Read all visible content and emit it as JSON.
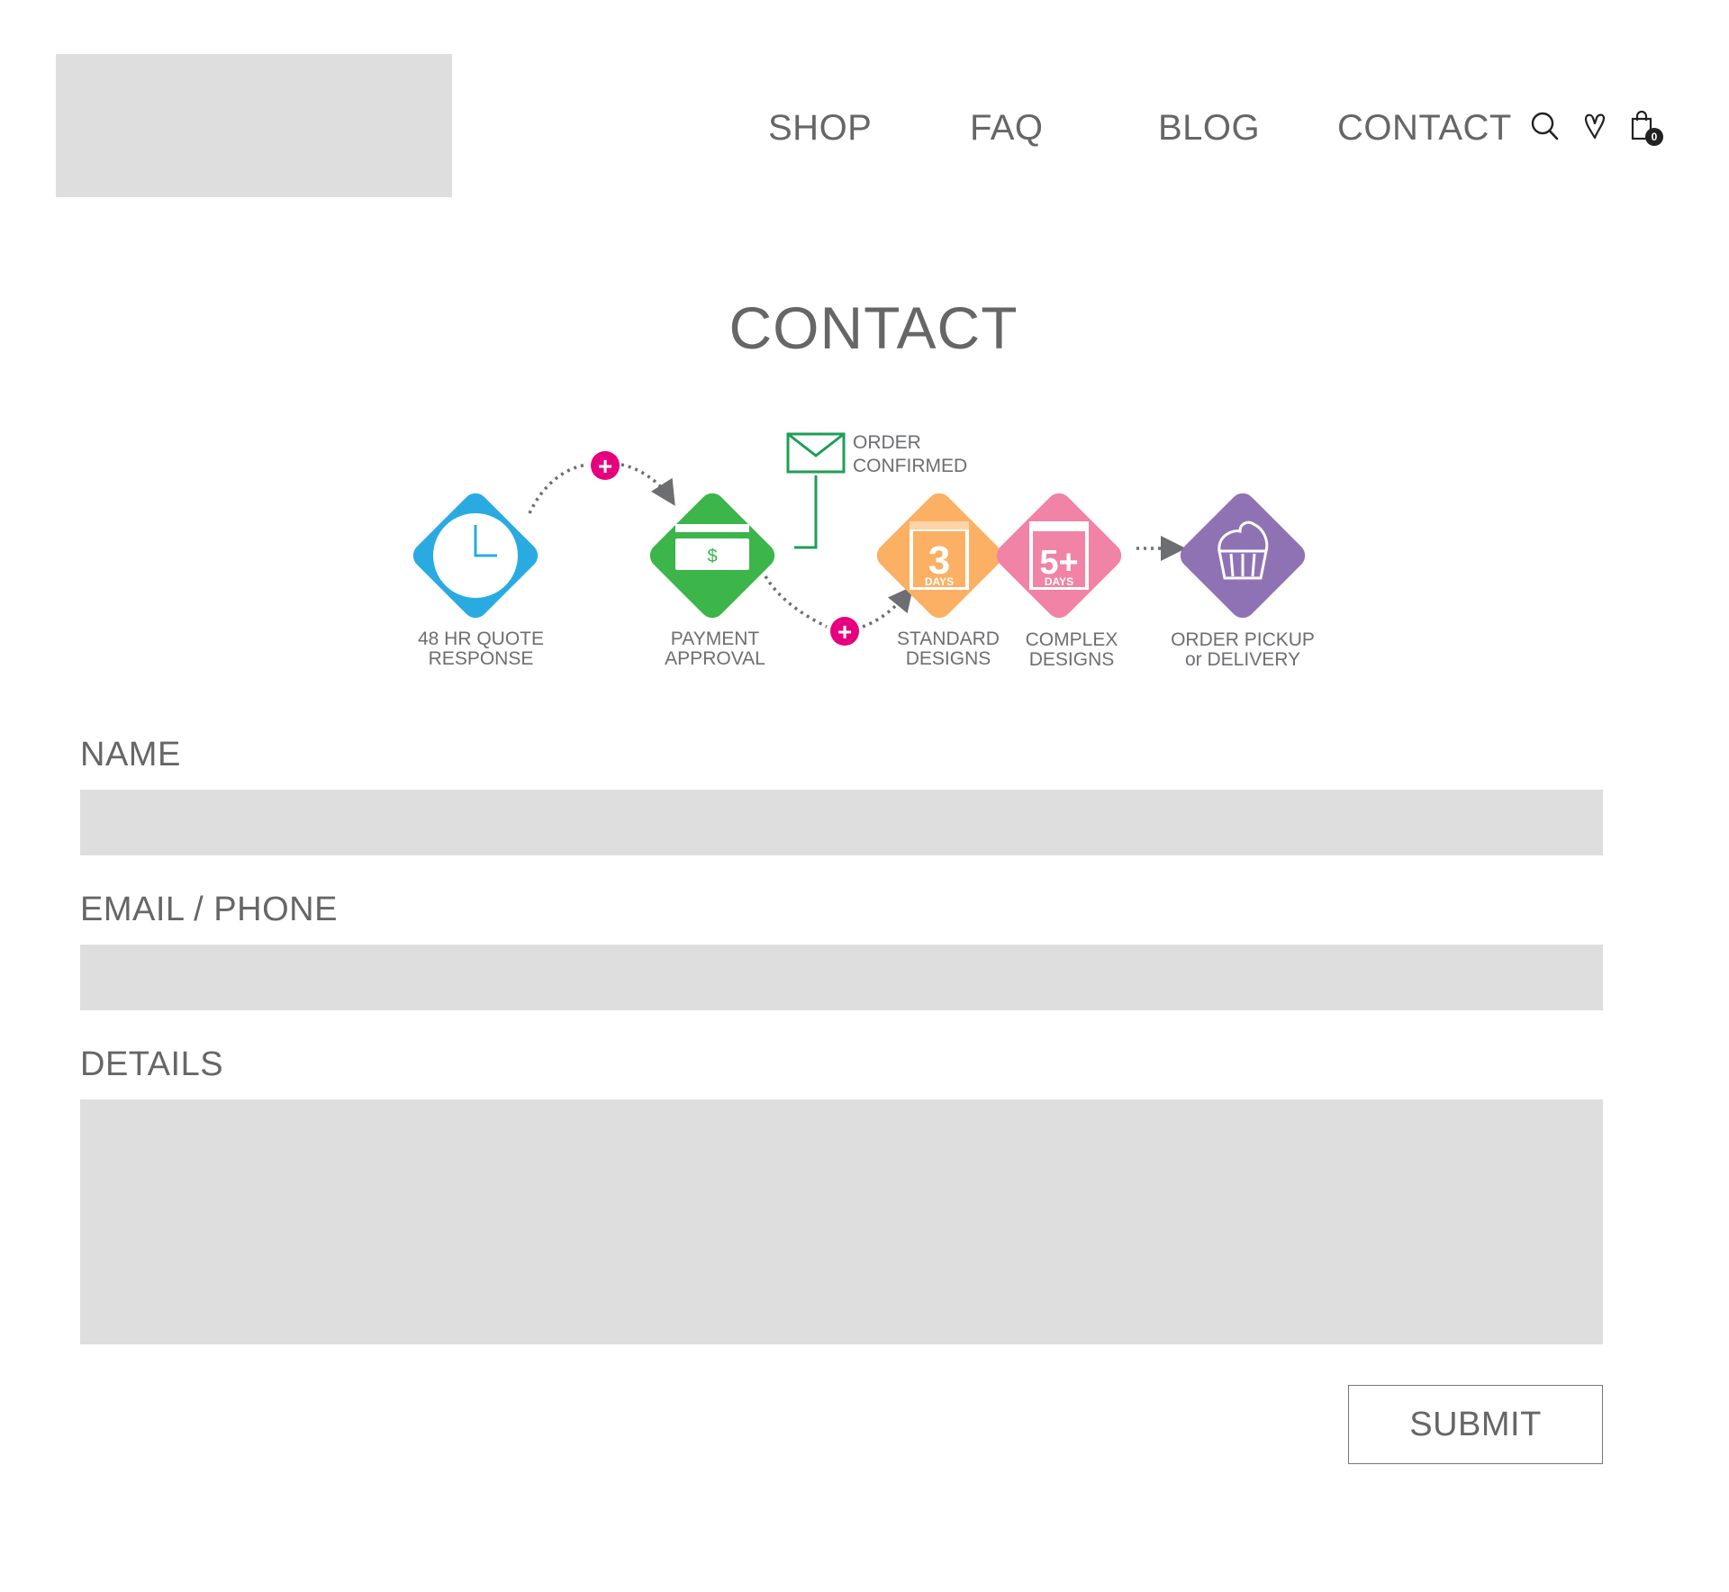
{
  "nav": {
    "links": [
      {
        "label": "SHOP"
      },
      {
        "label": "FAQ"
      },
      {
        "label": "BLOG"
      },
      {
        "label": "CONTACT"
      }
    ],
    "icons": {
      "search": "search-icon",
      "wishlist": "heart-icon",
      "cart": "shopping-bag-icon"
    },
    "cart_count": "0"
  },
  "page": {
    "title": "CONTACT"
  },
  "process": {
    "steps": [
      {
        "line1": "48 HR QUOTE",
        "line2": "RESPONSE",
        "color": "#29abe2"
      },
      {
        "line1": "PAYMENT",
        "line2": "APPROVAL",
        "color": "#3cb54a"
      },
      {
        "line1": "STANDARD",
        "line2": "DESIGNS",
        "color": "#fbb064",
        "days": "3",
        "days_label": "DAYS"
      },
      {
        "line1": "COMPLEX",
        "line2": "DESIGNS",
        "color": "#f083a6",
        "days": "5+",
        "days_label": "DAYS"
      },
      {
        "line1": "ORDER PICKUP",
        "line2": "or DELIVERY",
        "color": "#8f72b4"
      }
    ],
    "confirm": {
      "line1": "ORDER",
      "line2": "CONFIRMED",
      "color": "#1f9e57"
    },
    "plus_symbol": "+",
    "plus_color": "#e6007e",
    "currency_symbol": "$"
  },
  "form": {
    "name_label": "NAME",
    "email_label": "EMAIL / PHONE",
    "details_label": "DETAILS",
    "name_value": "",
    "email_value": "",
    "details_value": "",
    "submit_label": "SUBMIT"
  }
}
